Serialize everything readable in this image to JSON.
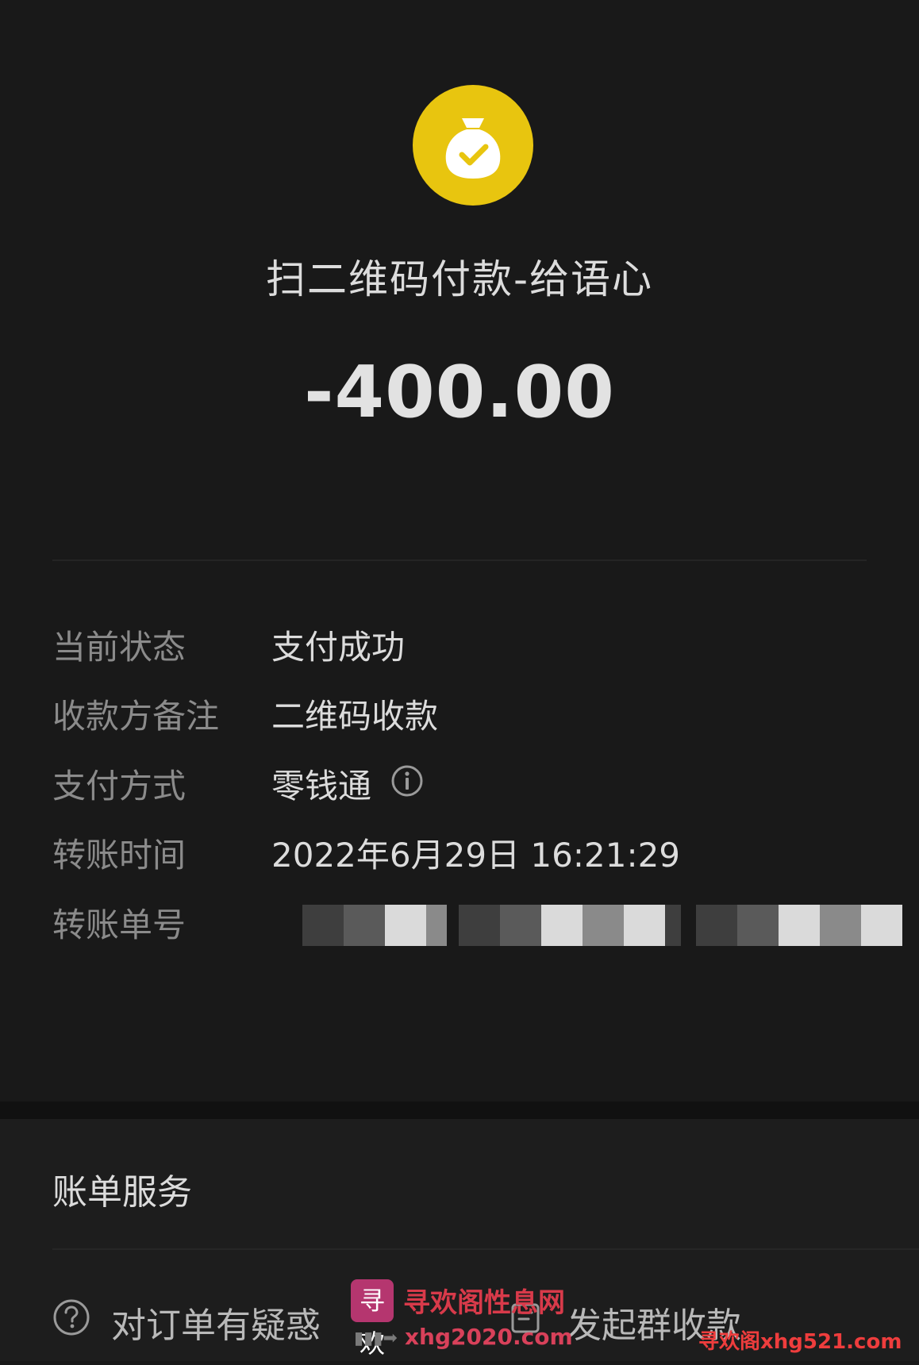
{
  "header": {
    "icon": "money-bag-check-icon",
    "title": "扫二维码付款-给语心",
    "amount": "-400.00"
  },
  "details": [
    {
      "label": "当前状态",
      "value": "支付成功"
    },
    {
      "label": "收款方备注",
      "value": "二维码收款"
    },
    {
      "label": "支付方式",
      "value": "零钱通",
      "icon": "info-icon"
    },
    {
      "label": "转账时间",
      "value": "2022年6月29日  16:21:29"
    },
    {
      "label": "转账单号",
      "value": ""
    }
  ],
  "bill_service": {
    "title": "账单服务",
    "actions": [
      {
        "label": "对订单有疑惑",
        "icon": "question-circle-icon"
      },
      {
        "label": "发起群收款",
        "icon": "group-collect-icon"
      }
    ]
  },
  "watermark": {
    "logo_text": "寻欢",
    "name": "寻欢阁性息网",
    "url": "xhg2020.com",
    "corner": "寻欢阁xhg521.com"
  },
  "colors": {
    "background": "#191919",
    "accent_yellow": "#e8c50f",
    "label_gray": "#8b8b8b",
    "value_white": "#dcdcdc"
  }
}
